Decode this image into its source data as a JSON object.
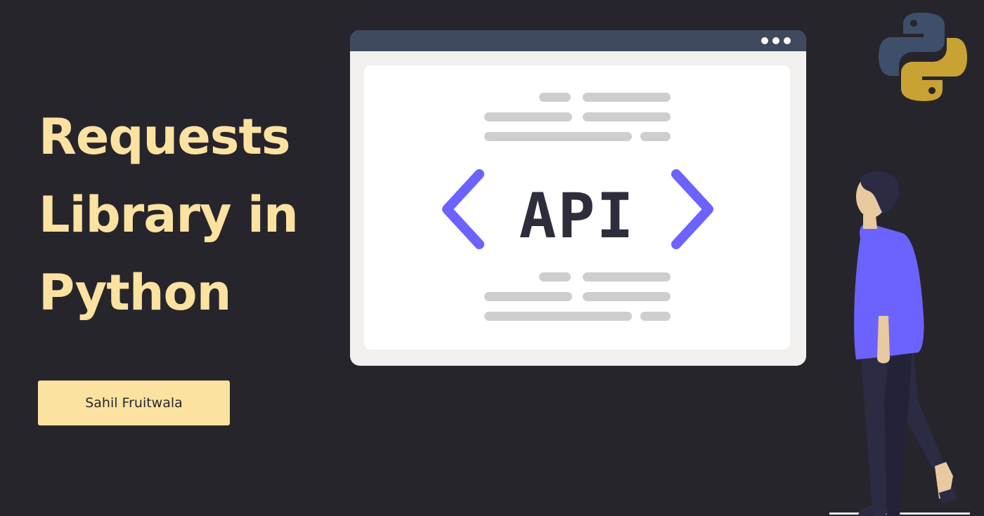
{
  "title": {
    "line1": "Requests",
    "line2": "Library in",
    "line3": "Python"
  },
  "author": "Sahil Fruitwala",
  "illustration": {
    "api_label": "API",
    "left_bracket_icon": "chevron-left-icon",
    "right_bracket_icon": "chevron-right-icon",
    "logo_icon": "python-logo-icon",
    "figure_icon": "person-illustration"
  },
  "colors": {
    "background": "#27252c",
    "title": "#fce2a0",
    "badge": "#fce2a0",
    "browser_bar": "#3f4a5e",
    "bracket": "#6c63ff",
    "api_text": "#2e2d3b",
    "python_blue": "#3e4f6b",
    "python_gold": "#c9a234"
  }
}
